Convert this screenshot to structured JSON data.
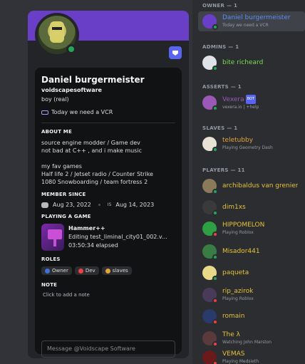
{
  "profile": {
    "display_name": "Daniel burgermeister",
    "username": "voidscapesoftware",
    "pronouns": "boy (real)",
    "custom_status": "Today we need a VCR",
    "about_title": "ABOUT ME",
    "about_lines": [
      "source engine modder / Game dev",
      "not bad at C++ , and i make music",
      "",
      "my fav games",
      "Half life 2 / Jetset radio / Counter Strike",
      "1080 Snowboarding / team fortress 2"
    ],
    "member_since_title": "MEMBER SINCE",
    "discord_since": "Aug 23, 2022",
    "server_abbrev": "IS",
    "server_since": "Aug 14, 2023",
    "playing_title": "PLAYING A GAME",
    "game": {
      "name": "Hammer++",
      "detail": "Editing test_liminal_city01_002.v...",
      "elapsed": "03:50:34 elapsed"
    },
    "roles_title": "ROLES",
    "roles": [
      {
        "name": "Owner",
        "color": "#3e70dd"
      },
      {
        "name": "Dev",
        "color": "#ed4245"
      },
      {
        "name": "slaves",
        "color": "#e6a337"
      }
    ],
    "note_title": "NOTE",
    "note_placeholder": "Click to add a note",
    "message_placeholder": "Message @Voidscape Software"
  },
  "members": {
    "groups": [
      {
        "title": "OWNER — 1"
      },
      {
        "title": "ADMINS — 1"
      },
      {
        "title": "ASSERTS — 1"
      },
      {
        "title": "SLAVES — 1"
      },
      {
        "title": "PLAYERS — 11"
      }
    ],
    "owner": {
      "name": "Daniel burgermeister",
      "sub": "Today we need a VCR",
      "color": "#5b8def"
    },
    "admin": {
      "name": "bite richeard",
      "color": "#7ed957"
    },
    "assert": {
      "name": "Vexera",
      "bot": "BOT",
      "sub": "vexera.io | +help",
      "color": "#9b59b6"
    },
    "slave": {
      "name": "teletubby",
      "sub": "Playing Geometry Dash",
      "color": "#e6a337"
    },
    "players": [
      {
        "name": "archibaldus van grenier",
        "sub": "",
        "color": "#e6c337"
      },
      {
        "name": "dim1xs",
        "sub": "",
        "color": "#e6c337"
      },
      {
        "name": "HIPPOMELON",
        "sub": "Playing Roblox",
        "color": "#e6c337"
      },
      {
        "name": "Misador441",
        "sub": "",
        "color": "#e6c337"
      },
      {
        "name": "paqueta",
        "sub": "",
        "color": "#e6c337"
      },
      {
        "name": "rip_azirok",
        "sub": "Playing Roblox",
        "color": "#e6c337"
      },
      {
        "name": "romain",
        "sub": "",
        "color": "#e6c337"
      },
      {
        "name": "The λ",
        "sub": "Watching John Marston",
        "color": "#e6c337"
      },
      {
        "name": "VEMAS",
        "sub": "Playing Medsieth",
        "color": "#e6c337"
      }
    ]
  }
}
